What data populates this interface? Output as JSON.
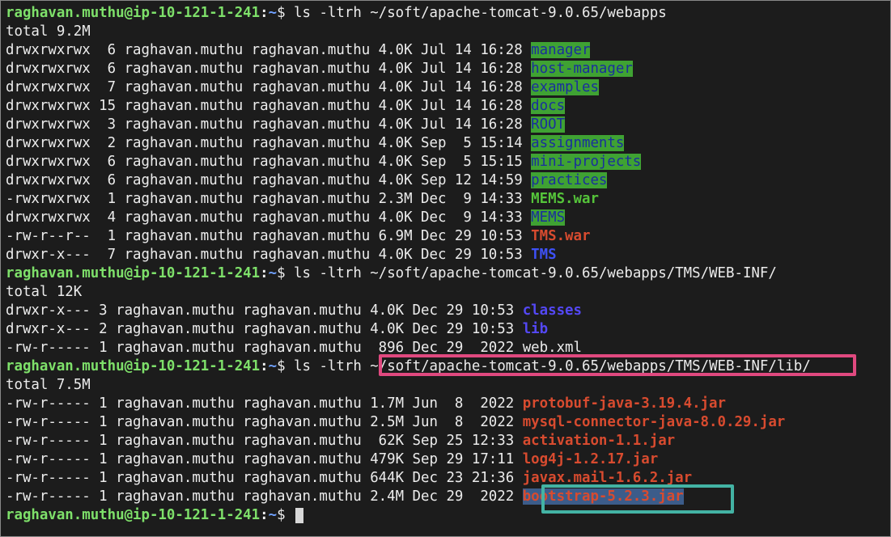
{
  "prompt": {
    "user_host": "raghavan.muthu@ip-10-121-1-241",
    "sep": ":",
    "path": "~",
    "dollar": "$ "
  },
  "cmd1": "ls -ltrh ~/soft/apache-tomcat-9.0.65/webapps",
  "total1": "total 9.2M",
  "listing1": [
    {
      "meta": "drwxrwxrwx  6 raghavan.muthu raghavan.muthu 4.0K Jul 14 16:28 ",
      "name": "manager",
      "kind": "dir-ow"
    },
    {
      "meta": "drwxrwxrwx  6 raghavan.muthu raghavan.muthu 4.0K Jul 14 16:28 ",
      "name": "host-manager",
      "kind": "dir-ow"
    },
    {
      "meta": "drwxrwxrwx  7 raghavan.muthu raghavan.muthu 4.0K Jul 14 16:28 ",
      "name": "examples",
      "kind": "dir-ow"
    },
    {
      "meta": "drwxrwxrwx 15 raghavan.muthu raghavan.muthu 4.0K Jul 14 16:28 ",
      "name": "docs",
      "kind": "dir-ow"
    },
    {
      "meta": "drwxrwxrwx  3 raghavan.muthu raghavan.muthu 4.0K Jul 14 16:28 ",
      "name": "ROOT",
      "kind": "dir-ow"
    },
    {
      "meta": "drwxrwxrwx  2 raghavan.muthu raghavan.muthu 4.0K Sep  5 15:14 ",
      "name": "assignments",
      "kind": "dir-ow"
    },
    {
      "meta": "drwxrwxrwx  6 raghavan.muthu raghavan.muthu 4.0K Sep  5 15:15 ",
      "name": "mini-projects",
      "kind": "dir-ow"
    },
    {
      "meta": "drwxrwxrwx  6 raghavan.muthu raghavan.muthu 4.0K Sep 12 14:59 ",
      "name": "practices",
      "kind": "dir-ow"
    },
    {
      "meta": "-rwxrwxrwx  1 raghavan.muthu raghavan.muthu 2.3M Dec  9 14:33 ",
      "name": "MEMS.war",
      "kind": "exe"
    },
    {
      "meta": "drwxrwxrwx  4 raghavan.muthu raghavan.muthu 4.0K Dec  9 14:33 ",
      "name": "MEMS",
      "kind": "dir-ow"
    },
    {
      "meta": "-rw-r--r--  1 raghavan.muthu raghavan.muthu 6.9M Dec 29 10:53 ",
      "name": "TMS.war",
      "kind": "archive"
    },
    {
      "meta": "drwxr-x---  7 raghavan.muthu raghavan.muthu 4.0K Dec 29 10:53 ",
      "name": "TMS",
      "kind": "dir-blue"
    }
  ],
  "cmd2": "ls -ltrh ~/soft/apache-tomcat-9.0.65/webapps/TMS/WEB-INF/",
  "total2": "total 12K",
  "listing2": [
    {
      "meta": "drwxr-x--- 3 raghavan.muthu raghavan.muthu 4.0K Dec 29 10:53 ",
      "name": "classes",
      "kind": "dir-blue-reg"
    },
    {
      "meta": "drwxr-x--- 2 raghavan.muthu raghavan.muthu 4.0K Dec 29 10:53 ",
      "name": "lib",
      "kind": "dir-blue-reg"
    },
    {
      "meta": "-rw-r----- 1 raghavan.muthu raghavan.muthu  896 Dec 29  2022 ",
      "name": "web.xml",
      "kind": "plain"
    }
  ],
  "cmd3_prefix": "ls -ltrh ",
  "cmd3_path": "~/soft/apache-tomcat-9.0.65/webapps/TMS/WEB-INF/lib/",
  "total3": "total 7.5M",
  "listing3": [
    {
      "meta": "-rw-r----- 1 raghavan.muthu raghavan.muthu 1.7M Jun  8  2022 ",
      "name": "protobuf-java-3.19.4.jar",
      "kind": "archive"
    },
    {
      "meta": "-rw-r----- 1 raghavan.muthu raghavan.muthu 2.5M Jun  8  2022 ",
      "name": "mysql-connector-java-8.0.29.jar",
      "kind": "archive"
    },
    {
      "meta": "-rw-r----- 1 raghavan.muthu raghavan.muthu  62K Sep 25 12:33 ",
      "name": "activation-1.1.jar",
      "kind": "archive"
    },
    {
      "meta": "-rw-r----- 1 raghavan.muthu raghavan.muthu 479K Sep 29 17:11 ",
      "name": "log4j-1.2.17.jar",
      "kind": "archive"
    },
    {
      "meta": "-rw-r----- 1 raghavan.muthu raghavan.muthu 644K Dec 23 21:36 ",
      "name": "javax.mail-1.6.2.jar",
      "kind": "archive"
    },
    {
      "meta": "-rw-r----- 1 raghavan.muthu raghavan.muthu 2.4M Dec 29  2022 ",
      "name": "bootstrap-5.2.3.jar",
      "kind": "selected-hl"
    }
  ]
}
